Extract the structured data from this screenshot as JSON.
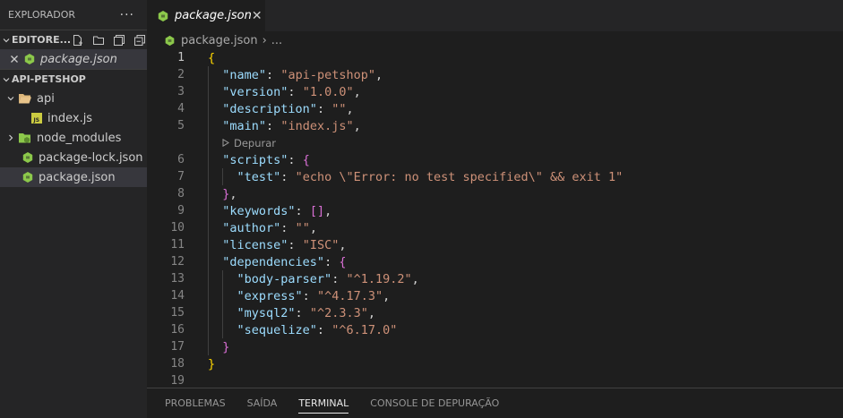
{
  "sidebar": {
    "title": "EXPLORADOR",
    "more": "···",
    "open_editors": {
      "title": "EDITORE...",
      "items": [
        {
          "label": "package.json",
          "icon": "nodejs-icon"
        }
      ]
    },
    "project": {
      "title": "API-PETSHOP",
      "items": [
        {
          "label": "api",
          "icon": "folder-open-icon"
        },
        {
          "label": "index.js",
          "icon": "js-file-icon"
        },
        {
          "label": "node_modules",
          "icon": "folder-node-icon"
        },
        {
          "label": "package-lock.json",
          "icon": "nodejs-icon"
        },
        {
          "label": "package.json",
          "icon": "nodejs-icon"
        }
      ]
    }
  },
  "tab": {
    "label": "package.json",
    "close": "✕"
  },
  "breadcrumb": {
    "file": "package.json",
    "sep": "›",
    "more": "..."
  },
  "editor": {
    "codelens": "Depurar",
    "line_numbers": [
      "1",
      "2",
      "3",
      "4",
      "5",
      "6",
      "7",
      "8",
      "9",
      "10",
      "11",
      "12",
      "13",
      "14",
      "15",
      "16",
      "17",
      "18",
      "19"
    ],
    "lines": [
      [
        {
          "t": "{",
          "c": "b1"
        }
      ],
      [
        {
          "t": "  "
        },
        {
          "t": "\"name\"",
          "c": "k"
        },
        {
          "t": ": "
        },
        {
          "t": "\"api-petshop\"",
          "c": "s"
        },
        {
          "t": ","
        }
      ],
      [
        {
          "t": "  "
        },
        {
          "t": "\"version\"",
          "c": "k"
        },
        {
          "t": ": "
        },
        {
          "t": "\"1.0.0\"",
          "c": "s"
        },
        {
          "t": ","
        }
      ],
      [
        {
          "t": "  "
        },
        {
          "t": "\"description\"",
          "c": "k"
        },
        {
          "t": ": "
        },
        {
          "t": "\"\"",
          "c": "s"
        },
        {
          "t": ","
        }
      ],
      [
        {
          "t": "  "
        },
        {
          "t": "\"main\"",
          "c": "k"
        },
        {
          "t": ": "
        },
        {
          "t": "\"index.js\"",
          "c": "s"
        },
        {
          "t": ","
        }
      ],
      [
        {
          "t": "  "
        },
        {
          "t": "\"scripts\"",
          "c": "k"
        },
        {
          "t": ": "
        },
        {
          "t": "{",
          "c": "b2"
        }
      ],
      [
        {
          "t": "    "
        },
        {
          "t": "\"test\"",
          "c": "k"
        },
        {
          "t": ": "
        },
        {
          "t": "\"echo \\\"Error: no test specified\\\" && exit 1\"",
          "c": "s"
        }
      ],
      [
        {
          "t": "  "
        },
        {
          "t": "}",
          "c": "b2"
        },
        {
          "t": ","
        }
      ],
      [
        {
          "t": "  "
        },
        {
          "t": "\"keywords\"",
          "c": "k"
        },
        {
          "t": ": "
        },
        {
          "t": "[]",
          "c": "b2"
        },
        {
          "t": ","
        }
      ],
      [
        {
          "t": "  "
        },
        {
          "t": "\"author\"",
          "c": "k"
        },
        {
          "t": ": "
        },
        {
          "t": "\"\"",
          "c": "s"
        },
        {
          "t": ","
        }
      ],
      [
        {
          "t": "  "
        },
        {
          "t": "\"license\"",
          "c": "k"
        },
        {
          "t": ": "
        },
        {
          "t": "\"ISC\"",
          "c": "s"
        },
        {
          "t": ","
        }
      ],
      [
        {
          "t": "  "
        },
        {
          "t": "\"dependencies\"",
          "c": "k"
        },
        {
          "t": ": "
        },
        {
          "t": "{",
          "c": "b2"
        }
      ],
      [
        {
          "t": "    "
        },
        {
          "t": "\"body-parser\"",
          "c": "k"
        },
        {
          "t": ": "
        },
        {
          "t": "\"^1.19.2\"",
          "c": "s"
        },
        {
          "t": ","
        }
      ],
      [
        {
          "t": "    "
        },
        {
          "t": "\"express\"",
          "c": "k"
        },
        {
          "t": ": "
        },
        {
          "t": "\"^4.17.3\"",
          "c": "s"
        },
        {
          "t": ","
        }
      ],
      [
        {
          "t": "    "
        },
        {
          "t": "\"mysql2\"",
          "c": "k"
        },
        {
          "t": ": "
        },
        {
          "t": "\"^2.3.3\"",
          "c": "s"
        },
        {
          "t": ","
        }
      ],
      [
        {
          "t": "    "
        },
        {
          "t": "\"sequelize\"",
          "c": "k"
        },
        {
          "t": ": "
        },
        {
          "t": "\"^6.17.0\"",
          "c": "s"
        }
      ],
      [
        {
          "t": "  "
        },
        {
          "t": "}",
          "c": "b2"
        }
      ],
      [
        {
          "t": "}",
          "c": "b1"
        }
      ],
      []
    ]
  },
  "panel": {
    "tabs": [
      {
        "label": "PROBLEMAS",
        "active": false
      },
      {
        "label": "SAÍDA",
        "active": false
      },
      {
        "label": "TERMINAL",
        "active": true
      },
      {
        "label": "CONSOLE DE DEPURAÇÃO",
        "active": false
      }
    ]
  },
  "colors": {
    "json_key": "#9cdcfe",
    "json_string": "#ce9178",
    "bracket_level1": "#ffd700",
    "bracket_level2": "#da70d6",
    "nodejs_icon": "#8cc84b",
    "js_icon": "#cbcb41",
    "folder_icon": "#dcb67a"
  }
}
